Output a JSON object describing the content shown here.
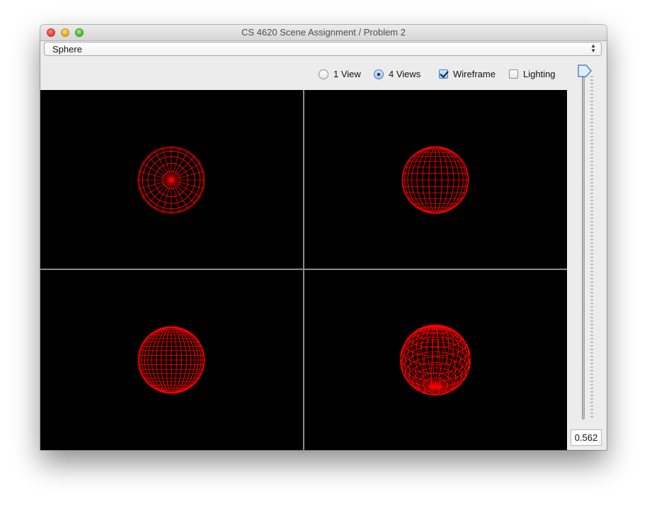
{
  "window": {
    "title": "CS 4620 Scene Assignment / Problem 2"
  },
  "scene_selector": {
    "selected": "Sphere"
  },
  "view_options": {
    "one_view_label": "1 View",
    "four_views_label": "4 Views",
    "selected_view": "4 Views",
    "wireframe_label": "Wireframe",
    "wireframe_checked": true,
    "lighting_label": "Lighting",
    "lighting_checked": false
  },
  "slider": {
    "value": "0.562",
    "level": 0.562
  },
  "viewports": [
    {
      "name": "top-left",
      "view": "pole-on"
    },
    {
      "name": "top-right",
      "view": "front"
    },
    {
      "name": "bottom-left",
      "view": "side"
    },
    {
      "name": "bottom-right",
      "view": "perspective"
    }
  ],
  "colors": {
    "wireframe": "#ff0000",
    "background": "#000000",
    "divider": "#8c8c8c"
  }
}
